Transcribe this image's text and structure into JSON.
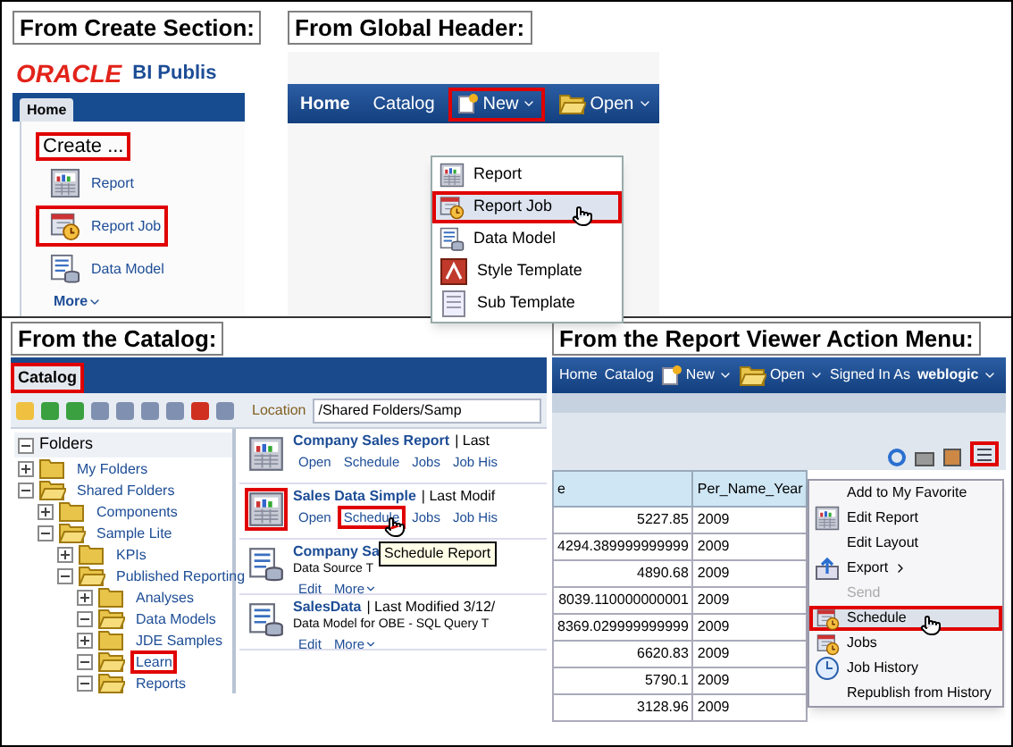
{
  "create_section": {
    "caption": "From Create Section:",
    "logo": "ORACLE",
    "product": "BI Publis",
    "tab": "Home",
    "heading": "Create ...",
    "heading_highlighted": true,
    "items": [
      {
        "label": "Report",
        "kind": "report",
        "highlighted": false
      },
      {
        "label": "Report Job",
        "kind": "job",
        "highlighted": true
      },
      {
        "label": "Data Model",
        "kind": "data_model",
        "highlighted": false
      }
    ],
    "more": "More"
  },
  "global_header": {
    "caption": "From Global Header:",
    "nav": [
      {
        "label": "Home",
        "kind": "bold",
        "highlighted": false
      },
      {
        "label": "Catalog",
        "kind": "link",
        "highlighted": false
      },
      {
        "label": "New",
        "kind": "new",
        "highlighted": true
      },
      {
        "label": "Open",
        "kind": "open",
        "highlighted": false
      }
    ],
    "menu": [
      {
        "label": "Report",
        "kind": "report",
        "highlighted": false
      },
      {
        "label": "Report Job",
        "kind": "job",
        "highlighted": true
      },
      {
        "label": "Data Model",
        "kind": "data_model",
        "highlighted": false
      },
      {
        "label": "Style Template",
        "kind": "style",
        "highlighted": false
      },
      {
        "label": "Sub Template",
        "kind": "sub",
        "highlighted": false
      }
    ]
  },
  "catalog": {
    "caption": "From the Catalog:",
    "tab": "Catalog",
    "tab_highlighted": true,
    "location_label": "Location",
    "location": "/Shared Folders/Samp",
    "folders_title": "Folders",
    "tree": [
      {
        "label": "My Folders",
        "expanded": false,
        "highlighted": false
      },
      {
        "label": "Shared Folders",
        "expanded": true,
        "highlighted": false,
        "children": [
          {
            "label": "Components",
            "expanded": false,
            "highlighted": false
          },
          {
            "label": "Sample Lite",
            "expanded": true,
            "highlighted": false,
            "children": [
              {
                "label": "KPIs",
                "expanded": false,
                "highlighted": false
              },
              {
                "label": "Published Reporting",
                "expanded": true,
                "highlighted": false,
                "children": [
                  {
                    "label": "Analyses",
                    "expanded": false,
                    "highlighted": false
                  },
                  {
                    "label": "Data Models",
                    "expanded": true,
                    "highlighted": false
                  },
                  {
                    "label": "JDE Samples",
                    "expanded": false,
                    "highlighted": false
                  },
                  {
                    "label": "Learn",
                    "expanded": true,
                    "highlighted": true
                  },
                  {
                    "label": "Reports",
                    "expanded": true,
                    "highlighted": false
                  }
                ]
              }
            ]
          }
        ]
      }
    ],
    "objects": [
      {
        "title": "Company Sales Report",
        "meta": "| Last",
        "kind": "report",
        "icon_highlighted": false,
        "links": [
          {
            "label": "Open",
            "highlighted": false
          },
          {
            "label": "Schedule",
            "highlighted": false
          },
          {
            "label": "Jobs",
            "highlighted": false
          },
          {
            "label": "Job His",
            "highlighted": false
          }
        ]
      },
      {
        "title": "Sales Data Simple",
        "meta": "| Last Modif",
        "kind": "report",
        "icon_highlighted": true,
        "links": [
          {
            "label": "Open",
            "highlighted": false
          },
          {
            "label": "Schedule",
            "highlighted": true
          },
          {
            "label": "Jobs",
            "highlighted": false
          },
          {
            "label": "Job His",
            "highlighted": false
          }
        ]
      },
      {
        "title": "Company Sa",
        "kind": "data_model",
        "icon_highlighted": false,
        "description": "Data Source T",
        "links": [
          {
            "label": "Edit",
            "highlighted": false
          },
          {
            "label": "More",
            "highlighted": false
          }
        ]
      },
      {
        "title": "SalesData",
        "meta": "| Last Modified 3/12/",
        "kind": "data_model",
        "icon_highlighted": false,
        "description": "Data Model for OBE - SQL Query T",
        "links": [
          {
            "label": "Edit",
            "highlighted": false
          },
          {
            "label": "More",
            "highlighted": false
          }
        ]
      }
    ],
    "tooltip": "Schedule Report"
  },
  "report_viewer": {
    "caption": "From the Report Viewer Action Menu:",
    "nav": [
      {
        "label": "Home",
        "kind": "link"
      },
      {
        "label": "Catalog",
        "kind": "link"
      },
      {
        "label": "New",
        "kind": "new"
      },
      {
        "label": "Open",
        "kind": "open"
      },
      {
        "label": "Signed In As",
        "kind": "link"
      },
      {
        "label": "weblogic",
        "kind": "user"
      }
    ],
    "action_button_highlighted": true,
    "columns": [
      "e",
      "Per_Name_Year"
    ],
    "rows": [
      [
        "5227.85",
        "2009"
      ],
      [
        "4294.389999999999",
        "2009"
      ],
      [
        "4890.68",
        "2009"
      ],
      [
        "8039.110000000001",
        "2009"
      ],
      [
        "8369.029999999999",
        "2009"
      ],
      [
        "6620.83",
        "2009"
      ],
      [
        "5790.1",
        "2009"
      ],
      [
        "3128.96",
        "2009"
      ]
    ],
    "menu": [
      {
        "label": "Add to My Favorite",
        "kind": "plain",
        "disabled": false,
        "highlighted": false
      },
      {
        "label": "Edit Report",
        "kind": "edit",
        "disabled": false,
        "highlighted": false
      },
      {
        "label": "Edit Layout",
        "kind": "plain",
        "disabled": false,
        "highlighted": false
      },
      {
        "label": "Export",
        "kind": "export",
        "disabled": false,
        "highlighted": false
      },
      {
        "label": "Send",
        "kind": "plain",
        "disabled": true,
        "highlighted": false
      },
      {
        "label": "Schedule",
        "kind": "job",
        "disabled": false,
        "highlighted": true
      },
      {
        "label": "Jobs",
        "kind": "job",
        "disabled": false,
        "highlighted": false
      },
      {
        "label": "Job History",
        "kind": "history",
        "disabled": false,
        "highlighted": false
      },
      {
        "label": "Republish from History",
        "kind": "plain",
        "disabled": false,
        "highlighted": false
      }
    ]
  }
}
